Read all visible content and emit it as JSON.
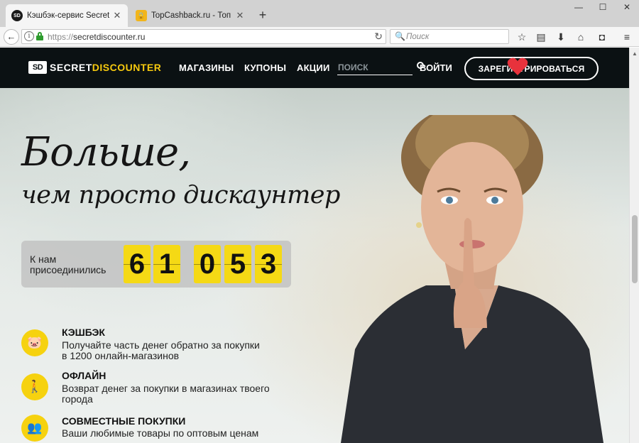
{
  "browser": {
    "tabs": [
      {
        "title": "Кэшбэк-сервис SecretDisco",
        "favicon": "sd-logo-icon",
        "active": true
      },
      {
        "title": "TopCashback.ru - Топ лучш",
        "favicon": "lock-favicon-icon",
        "active": false
      }
    ],
    "new_tab": "+",
    "window": {
      "minimize": "—",
      "maximize": "☐",
      "close": "✕"
    },
    "url": {
      "scheme": "https://",
      "host": "secretdiscounter.ru"
    },
    "search_placeholder": "Поиск"
  },
  "site": {
    "logo": {
      "mark": "SD",
      "secret": "SECRET",
      "discounter": "DISCOUNTER"
    },
    "nav": [
      "МАГАЗИНЫ",
      "КУПОНЫ",
      "АКЦИИ"
    ],
    "search_placeholder": "ПОИСК",
    "login": "ВОЙТИ",
    "register": "ЗАРЕГИСТРИРОВАТЬСЯ",
    "headline_1": "Больше,",
    "headline_2": "чем просто дискаунтер",
    "counter": {
      "label_1": "К нам",
      "label_2": "присоединились",
      "digits": [
        "6",
        "1",
        "0",
        "5",
        "3"
      ]
    },
    "features": [
      {
        "icon": "piggy-bank-icon",
        "title": "КЭШБЭК",
        "desc_1": "Получайте часть денег обратно за покупки",
        "desc_2": "в 1200 онлайн-магазинов"
      },
      {
        "icon": "shopper-icon",
        "title": "ОФЛАЙН",
        "desc_1": "Возврат денег за покупки в магазинах твоего",
        "desc_2": "города"
      },
      {
        "icon": "group-icon",
        "title": "СОВМЕСТНЫЕ ПОКУПКИ",
        "desc_1": "Ваши любимые товары по оптовым ценам",
        "desc_2": ""
      }
    ]
  },
  "colors": {
    "accent": "#f6d20f",
    "header_bg": "#0b1113",
    "heart": "#e8323c"
  }
}
